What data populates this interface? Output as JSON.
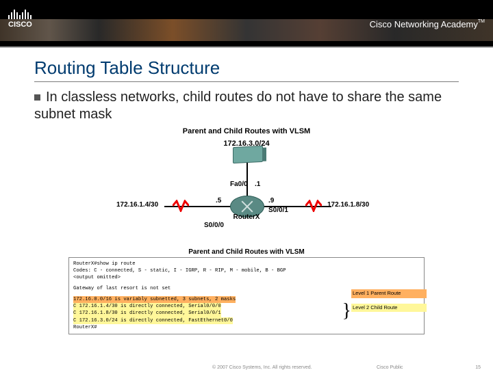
{
  "header": {
    "logo_text": "CISCO",
    "academy": "Cisco Networking Academy",
    "tm": "TM"
  },
  "title": "Routing Table Structure",
  "bullet": "In classless networks, child routes do not have to share the same subnet mask",
  "diagram": {
    "title": "Parent and Child Routes with VLSM",
    "top_net": "172.16.3.0/24",
    "left_net": "172.16.1.4/30",
    "right_net": "172.16.1.8/30",
    "router_label": "RouterX",
    "fa00": "Fa0/0",
    "dot1": ".1",
    "dot5": ".5",
    "dot9": ".9",
    "s000": "S0/0/0",
    "s001": "S0/0/1"
  },
  "route_table": {
    "title": "Parent and Child Routes with VLSM",
    "cmd": "RouterX#show ip route",
    "codes": "Codes: C - connected, S - static, I - IGRP, R - RIP, M - mobile, B - BGP",
    "omitted": "<output omitted>",
    "gateway": "Gateway of last resort is not set",
    "parent": "     172.16.0.0/16 is variably subnetted, 3 subnets, 2 masks",
    "c1": "C       172.16.1.4/30 is directly connected, Serial0/0/0",
    "c2": "C       172.16.1.8/30 is directly connected, Serial0/0/1",
    "c3": "C       172.16.3.0/24 is directly connected, FastEthernet0/0",
    "prompt": "RouterX#",
    "label_parent": "Level 1 Parent Route",
    "label_child": "Level 2 Child Route"
  },
  "footer": {
    "copyright": "© 2007 Cisco Systems, Inc. All rights reserved.",
    "class": "Cisco Public",
    "page": "15"
  }
}
